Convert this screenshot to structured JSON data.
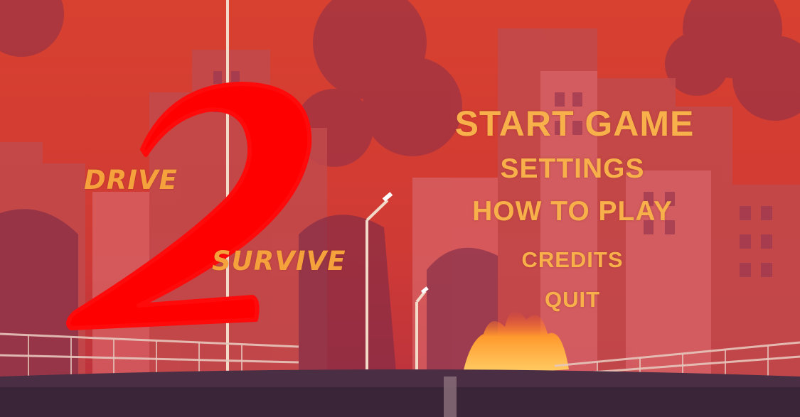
{
  "logo": {
    "word_top": "DRIVE",
    "number": "2",
    "word_bottom": "SURVIVE"
  },
  "menu": {
    "start": "START GAME",
    "settings": "SETTINGS",
    "how_to_play": "HOW TO PLAY",
    "credits": "CREDITS",
    "quit": "QUIT"
  },
  "colors": {
    "menu_text": "#f7b04a",
    "logo_number": "#ff0000",
    "sky": "#c93a2e"
  }
}
